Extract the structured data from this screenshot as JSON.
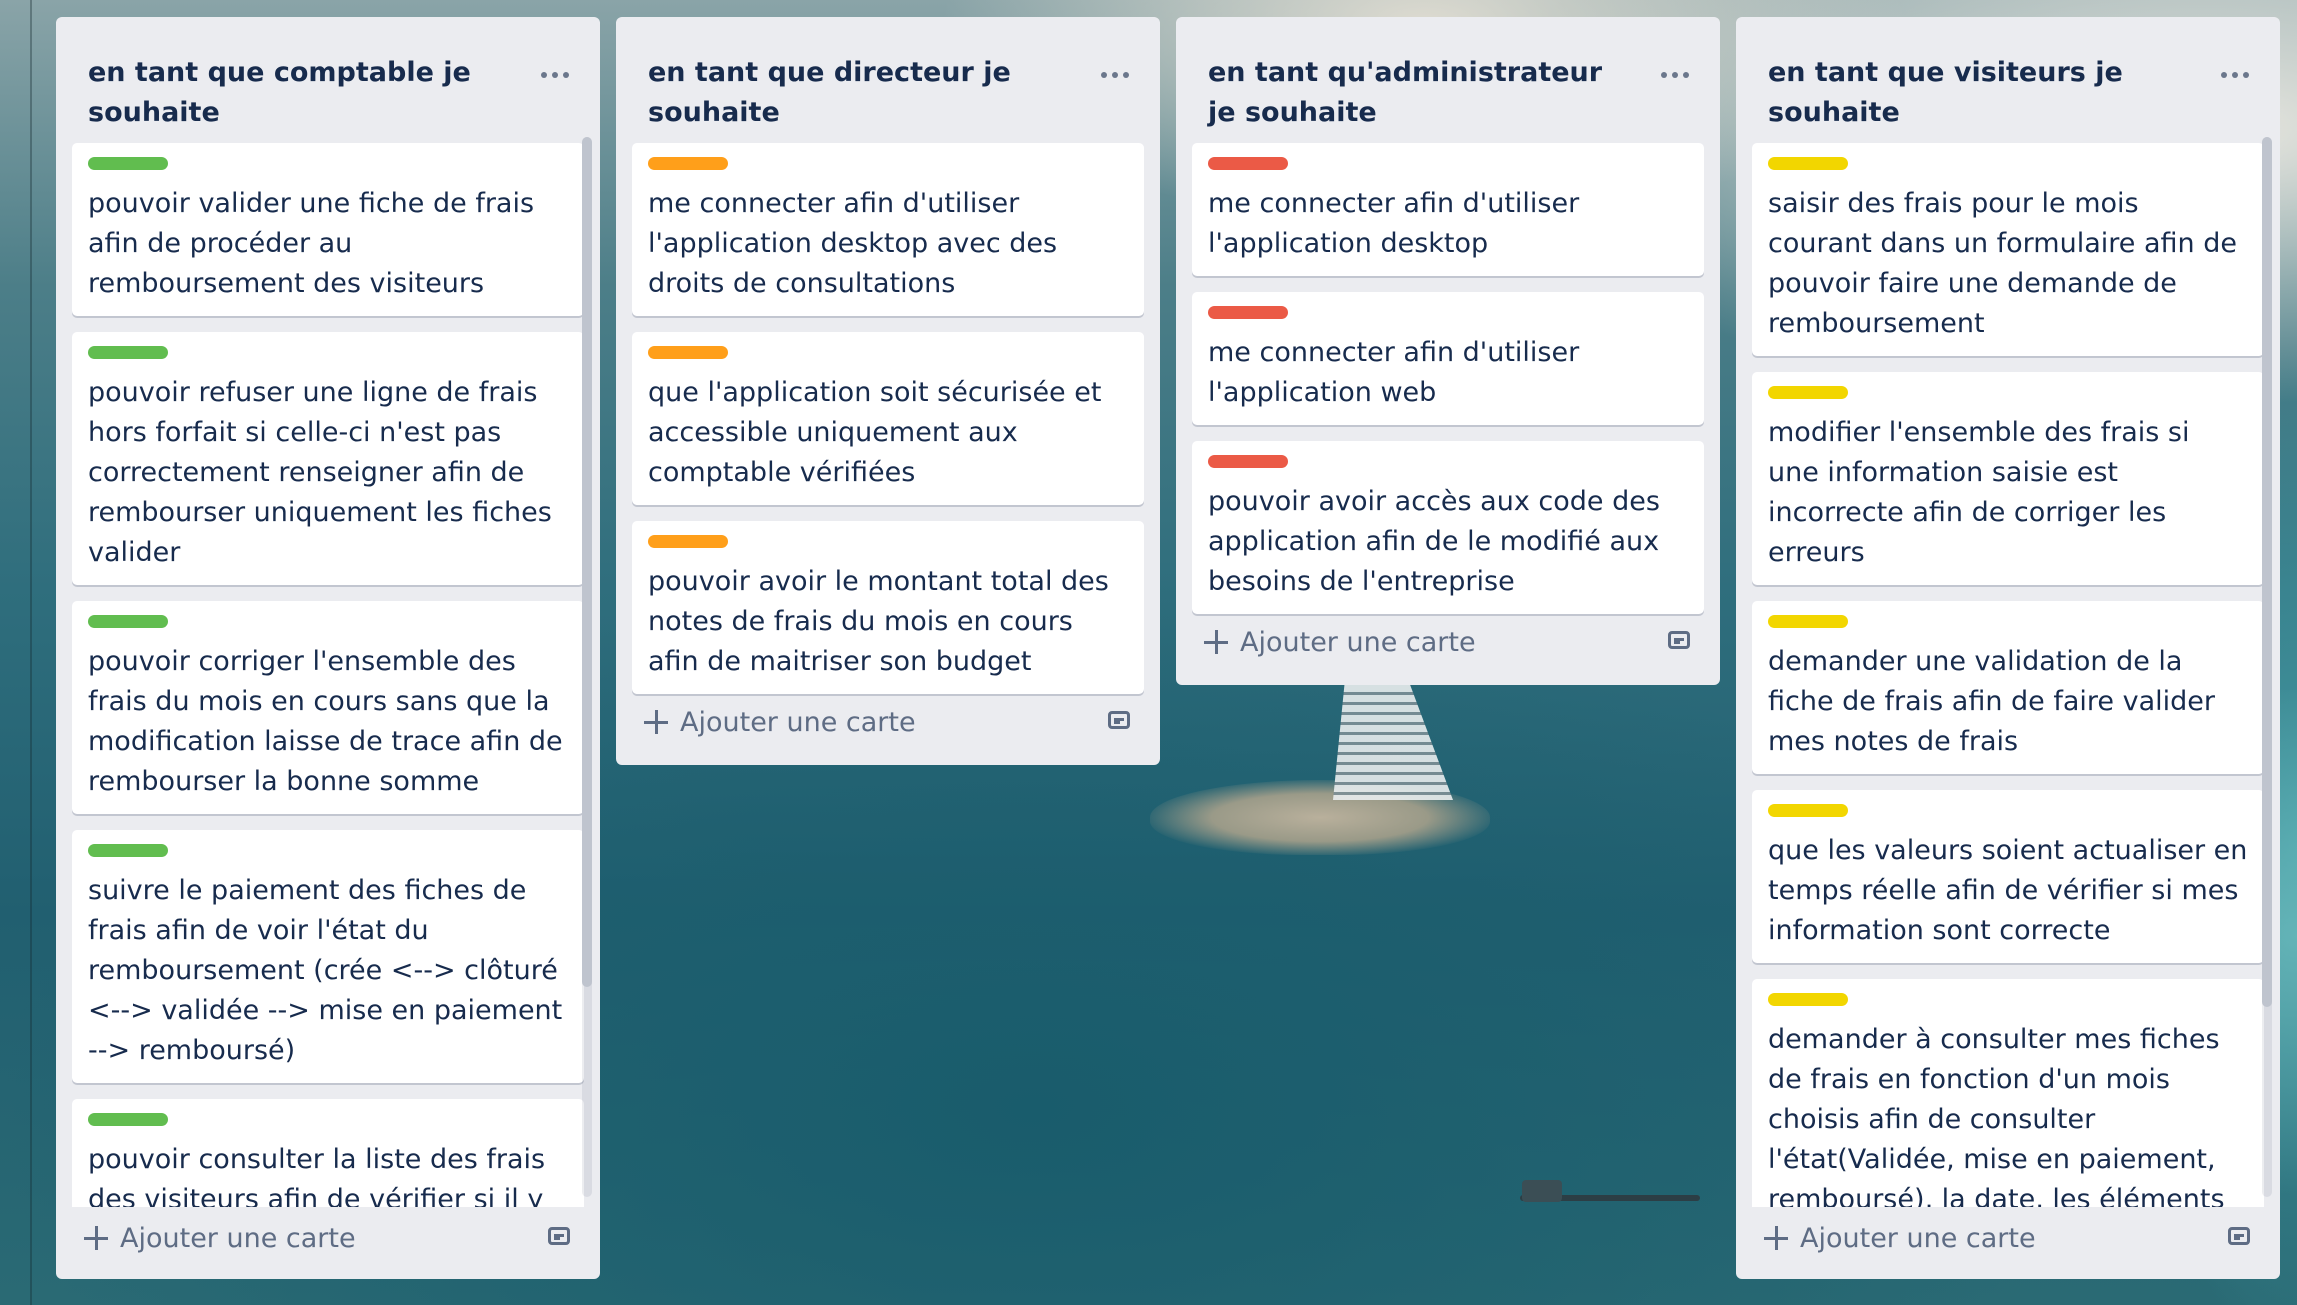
{
  "colors": {
    "green_label": "#61bd4f",
    "orange_label": "#ff9f1a",
    "red_label": "#eb5a46",
    "yellow_label": "#f2d600",
    "list_bg": "#ebecf0",
    "card_bg": "#ffffff",
    "text": "#172b4d",
    "muted": "#5e6c84"
  },
  "icons": {
    "list_menu": "ellipsis-icon",
    "add": "plus-icon",
    "template": "card-template-icon"
  },
  "lists": [
    {
      "title": "en tant que comptable je souhaite",
      "add_card_label": "Ajouter une carte",
      "cards": [
        {
          "label_color": "green",
          "text": "pouvoir valider une fiche de frais afin de procéder au remboursement des visiteurs"
        },
        {
          "label_color": "green",
          "text": "pouvoir refuser une ligne de frais hors forfait si celle-ci n'est pas correctement renseigner afin de rembourser uniquement les fiches valider"
        },
        {
          "label_color": "green",
          "text": "pouvoir corriger l'ensemble des frais du mois en cours sans que la modification laisse de trace afin de rembourser la bonne somme"
        },
        {
          "label_color": "green",
          "text": "suivre le paiement des fiches de frais afin de voir l'état du remboursement (crée <--> clôturé <--> validée --> mise en paiement --> remboursé)"
        },
        {
          "label_color": "green",
          "text": "pouvoir consulter la liste des frais des visiteurs afin de vérifier si il y a d'éventuelle erreurs"
        }
      ]
    },
    {
      "title": "en tant que directeur je souhaite",
      "add_card_label": "Ajouter une carte",
      "cards": [
        {
          "label_color": "orange",
          "text": "me connecter afin d'utiliser l'application desktop avec des droits de consultations"
        },
        {
          "label_color": "orange",
          "text": "que l'application soit sécurisée et accessible uniquement aux comptable vérifiées"
        },
        {
          "label_color": "orange",
          "text": "pouvoir avoir le montant total des notes de frais du mois en cours afin de maitriser son budget"
        }
      ]
    },
    {
      "title": "en tant qu'administrateur je souhaite",
      "add_card_label": "Ajouter une carte",
      "cards": [
        {
          "label_color": "red",
          "text": "me connecter afin d'utiliser l'application desktop"
        },
        {
          "label_color": "red",
          "text": "me connecter afin d'utiliser l'application web"
        },
        {
          "label_color": "red",
          "text": "pouvoir avoir accès aux code des application afin de le modifié aux besoins de l'entreprise"
        }
      ]
    },
    {
      "title": "en tant que visiteurs je souhaite",
      "add_card_label": "Ajouter une carte",
      "cards": [
        {
          "label_color": "yellow",
          "text": "saisir des frais pour le mois courant dans un formulaire afin de pouvoir faire une demande de remboursement"
        },
        {
          "label_color": "yellow",
          "text": "modifier l'ensemble des frais si une information saisie est incorrecte afin de corriger les erreurs"
        },
        {
          "label_color": "yellow",
          "text": "demander une validation de la fiche de frais afin de faire valider mes notes de frais"
        },
        {
          "label_color": "yellow",
          "text": "que les valeurs soient actualiser en temps réelle afin de vérifier si mes information sont correcte"
        },
        {
          "label_color": "yellow",
          "text": "demander à consulter mes fiches de frais en fonction d'un mois choisis afin de consulter l'état(Validée, mise en paiement, remboursé), la date, les éléments forfaitisés, quantité pour chaque type de frais, montant, libellé et"
        }
      ]
    }
  ]
}
